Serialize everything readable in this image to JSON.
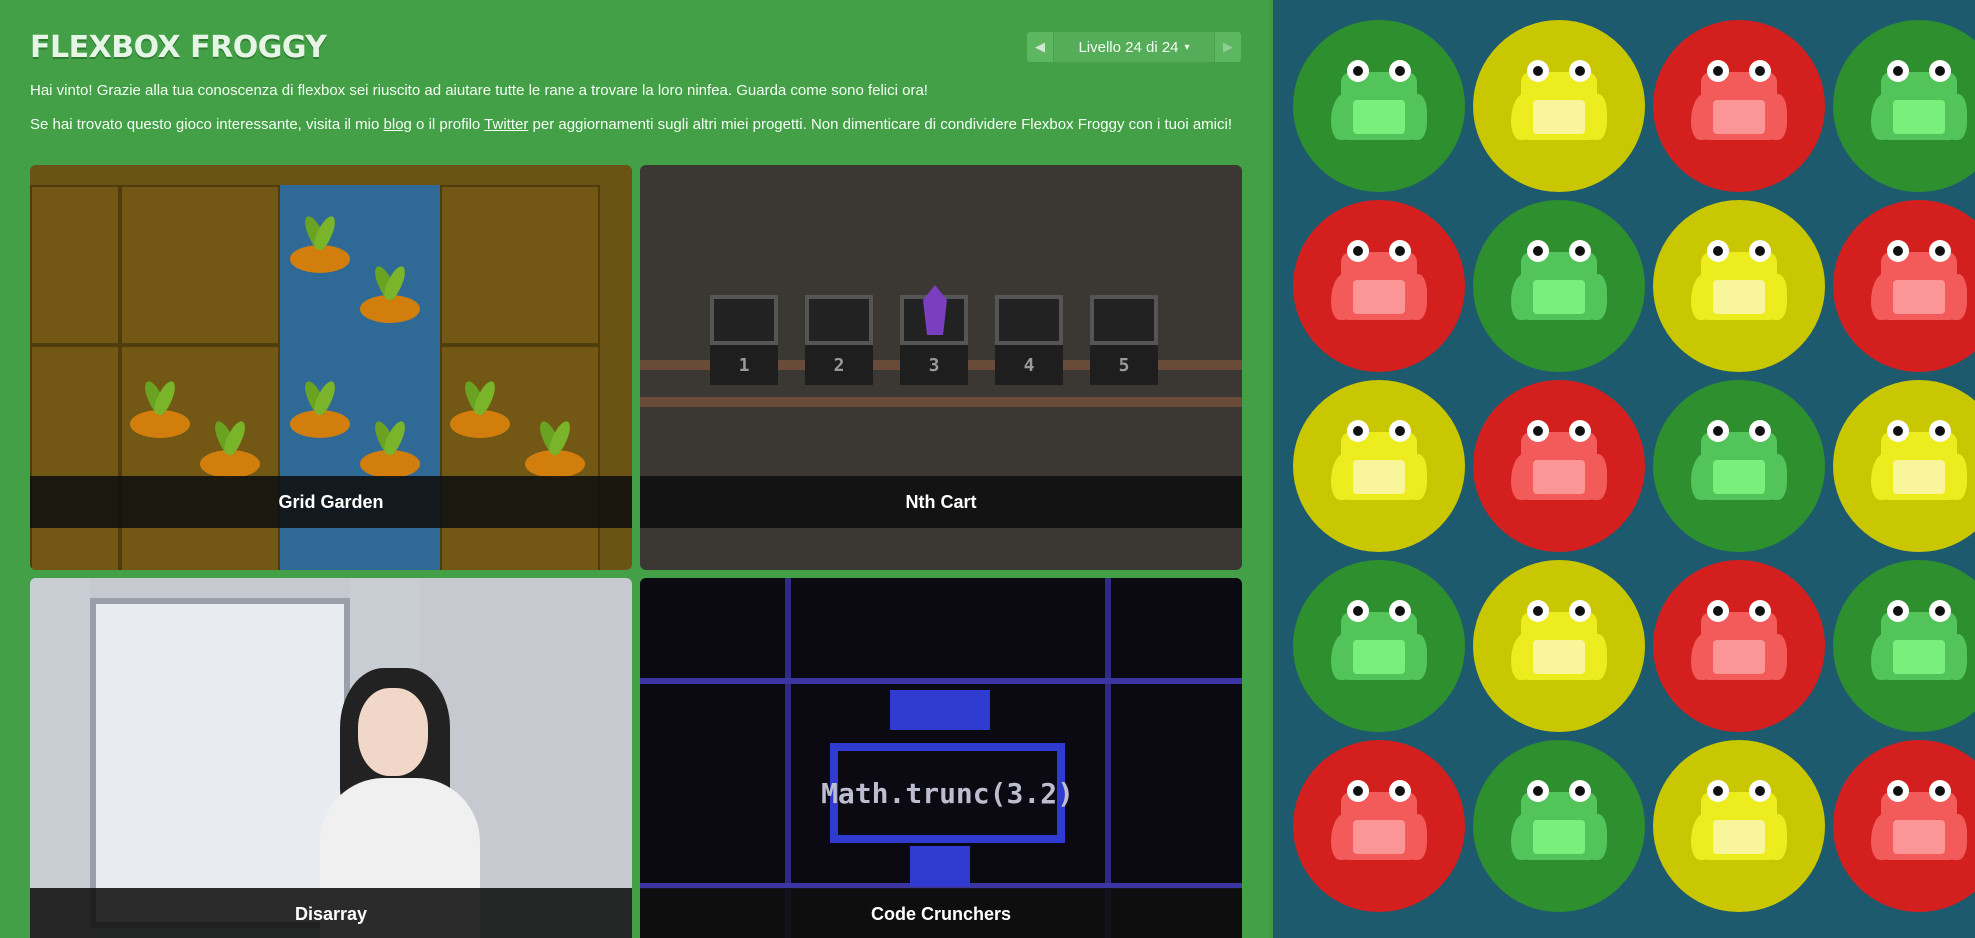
{
  "app": {
    "title": "FLEXBOX FROGGY",
    "level_nav": {
      "prev_icon": "chevron-left-icon",
      "level_label": "Livello 24 di 24",
      "caret": "▾",
      "next_icon": "chevron-right-icon"
    }
  },
  "messages": {
    "win": "Hai vinto! Grazie alla tua conoscenza di flexbox sei riuscito ad aiutare tutte le rane a trovare la loro ninfea. Guarda come sono felici ora!",
    "promo_before": "Se hai trovato questo gioco interessante, visita il mio ",
    "blog_link": "blog",
    "promo_mid": " o il profilo ",
    "twitter_link": "Twitter",
    "promo_after": " per aggiornamenti sugli altri miei progetti. Non dimenticare di condividere Flexbox Froggy con i tuoi amici!"
  },
  "games": [
    {
      "label": "Grid Garden"
    },
    {
      "label": "Nth Cart",
      "cart_numbers": [
        "1",
        "2",
        "3",
        "4",
        "5"
      ]
    },
    {
      "label": "Disarray"
    },
    {
      "label": "Code Crunchers",
      "screen_text": "Math.trunc(3.2)"
    }
  ],
  "pond": {
    "rows": [
      [
        "green",
        "yellow",
        "red",
        "green"
      ],
      [
        "red",
        "green",
        "yellow",
        "red"
      ],
      [
        "yellow",
        "red",
        "green",
        "yellow"
      ],
      [
        "green",
        "yellow",
        "red",
        "green"
      ],
      [
        "red",
        "green",
        "yellow",
        "red"
      ]
    ],
    "colors": {
      "green": "#2e8f2e",
      "yellow": "#c9c702",
      "red": "#d41f1f",
      "water": "#1e5a6e"
    }
  }
}
